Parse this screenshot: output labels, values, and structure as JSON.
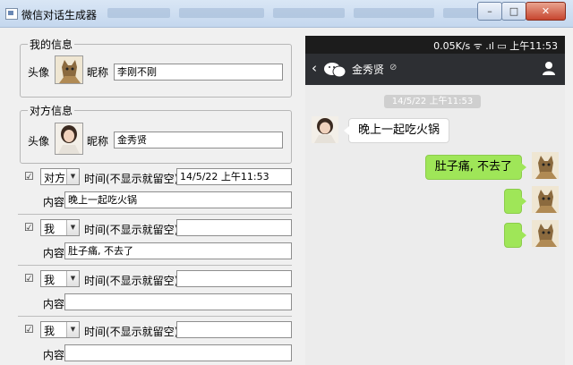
{
  "window": {
    "title": "微信对话生成器",
    "minimize_label": "–",
    "maximize_label": "□",
    "close_label": "✕"
  },
  "my_info": {
    "group_title": "我的信息",
    "avatar_label": "头像",
    "nickname_label": "昵称",
    "nickname_value": "李刚不刚"
  },
  "other_info": {
    "group_title": "对方信息",
    "avatar_label": "头像",
    "nickname_label": "昵称",
    "nickname_value": "金秀贤"
  },
  "messages": [
    {
      "checked": "☑",
      "speaker": "对方",
      "time_label": "时间(不显示就留空)",
      "time_value": "14/5/22 上午11:53",
      "content_label": "内容",
      "content_value": "晚上一起吃火锅"
    },
    {
      "checked": "☑",
      "speaker": "我",
      "time_label": "时间(不显示就留空)",
      "time_value": "",
      "content_label": "内容",
      "content_value": "肚子痛, 不去了"
    },
    {
      "checked": "☑",
      "speaker": "我",
      "time_label": "时间(不显示就留空)",
      "time_value": "",
      "content_label": "内容",
      "content_value": ""
    },
    {
      "checked": "☑",
      "speaker": "我",
      "time_label": "时间(不显示就留空)",
      "time_value": "",
      "content_label": "内容",
      "content_value": ""
    }
  ],
  "phone": {
    "status_text": "0.05K/s ᯤ .ıl ▭ 上午11:53",
    "back_icon": "‹",
    "chat_name": "金秀贤",
    "mute_icon": "⊘",
    "time_chip": "14/5/22 上午11:53",
    "incoming_text": "晚上一起吃火锅",
    "outgoing_text": "肚子痛, 不去了",
    "accent_color": "#9fe658"
  }
}
